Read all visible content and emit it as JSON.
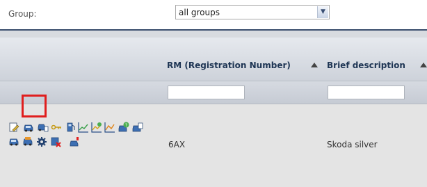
{
  "group": {
    "label": "Group:",
    "selected": "all groups"
  },
  "table": {
    "columns": [
      {
        "title": "RM (Registration Number)"
      },
      {
        "title": "Brief description"
      }
    ],
    "rows": [
      {
        "rm": "6AX",
        "description": "Skoda silver"
      }
    ],
    "row_actions": [
      "edit-icon",
      "car-icon",
      "car-detail-icon",
      "key-icon",
      "fuel-icon",
      "chart-icon",
      "trip-chart-icon",
      "drive-chart-icon",
      "car-info-icon",
      "car-print-icon",
      "car-blue-icon",
      "car-orange-icon",
      "gear-icon",
      "delete-icon",
      "car-pin-icon"
    ]
  },
  "colors": {
    "header_dark": "#3b4f6e",
    "header_text": "#1e3554",
    "highlight": "#e01e1e",
    "row_bg": "#e4e4e4"
  }
}
